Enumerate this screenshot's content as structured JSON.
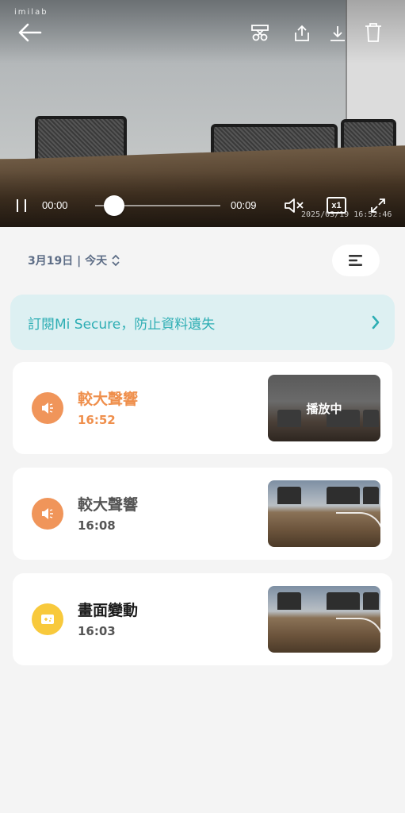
{
  "player": {
    "brand": "imilab",
    "current_time": "00:00",
    "duration": "00:09",
    "progress": 0.0,
    "speed": "x1",
    "timestamp": "2025/03/19 16:52:46",
    "icons": [
      "back-arrow-icon",
      "scissors-icon",
      "share-icon",
      "download-icon",
      "trash-icon",
      "pause-icon",
      "mute-icon",
      "fullscreen-icon"
    ]
  },
  "date_bar": {
    "label": "3月19日 | 今天"
  },
  "banner": {
    "text": "訂閱Mi Secure，防止資料遺失",
    "color": "#2eaeb4",
    "background": "#ddf0f2"
  },
  "events": [
    {
      "title": "較大聲響",
      "time": "16:52",
      "icon": "speaker-icon",
      "icon_color": "#f0955a",
      "title_color": "#ef8f4c",
      "active": true,
      "thumb_label": "播放中"
    },
    {
      "title": "較大聲響",
      "time": "16:08",
      "icon": "speaker-icon",
      "icon_color": "#f0955a",
      "title_color": "#555555",
      "active": false
    },
    {
      "title": "畫面變動",
      "time": "16:03",
      "icon": "motion-icon",
      "icon_color": "#f8c93c",
      "title_color": "#1a1a1a",
      "active": false
    }
  ]
}
